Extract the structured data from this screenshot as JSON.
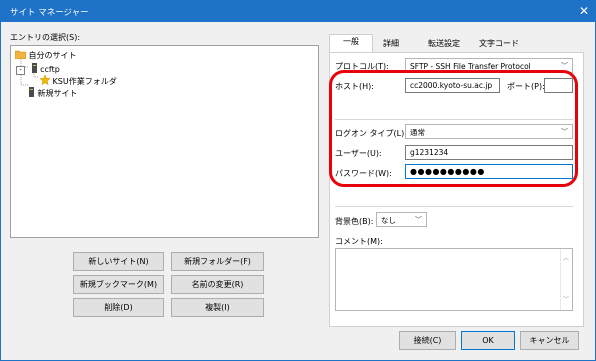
{
  "window": {
    "title": "サイト マネージャー",
    "close_glyph": "✕"
  },
  "left": {
    "select_entry_label": "エントリの選択(S):",
    "tree": {
      "root": "自分のサイト",
      "server": "ccftp",
      "folder": "KSU作業フォルダ",
      "new_site": "新規サイト"
    },
    "buttons": {
      "new_site": "新しいサイト(N)",
      "new_folder": "新規フォルダー(F)",
      "new_bookmark": "新規ブックマーク(M)",
      "rename": "名前の変更(R)",
      "delete": "削除(D)",
      "copy": "複製(I)"
    }
  },
  "tabs": [
    "一般",
    "詳細",
    "転送設定",
    "文字コード"
  ],
  "general": {
    "protocol_label": "プロトコル(T):",
    "protocol_value": "SFTP - SSH File Transfer Protocol",
    "host_label": "ホスト(H):",
    "host_value": "cc2000.kyoto-su.ac.jp",
    "port_label": "ポート(P):",
    "port_value": "",
    "logon_type_label": "ログオン タイプ(L):",
    "logon_type_value": "通常",
    "user_label": "ユーザー(U):",
    "user_value": "g1231234",
    "password_label": "パスワード(W):",
    "password_value": "●●●●●●●●●●",
    "bg_color_label": "背景色(B):",
    "bg_color_value": "なし",
    "comment_label": "コメント(M):"
  },
  "footer": {
    "connect": "接続(C)",
    "ok": "OK",
    "cancel": "キャンセル"
  },
  "colors": {
    "titlebar": "#1e73c8",
    "highlight": "#e8000b",
    "focus": "#0078d7"
  }
}
